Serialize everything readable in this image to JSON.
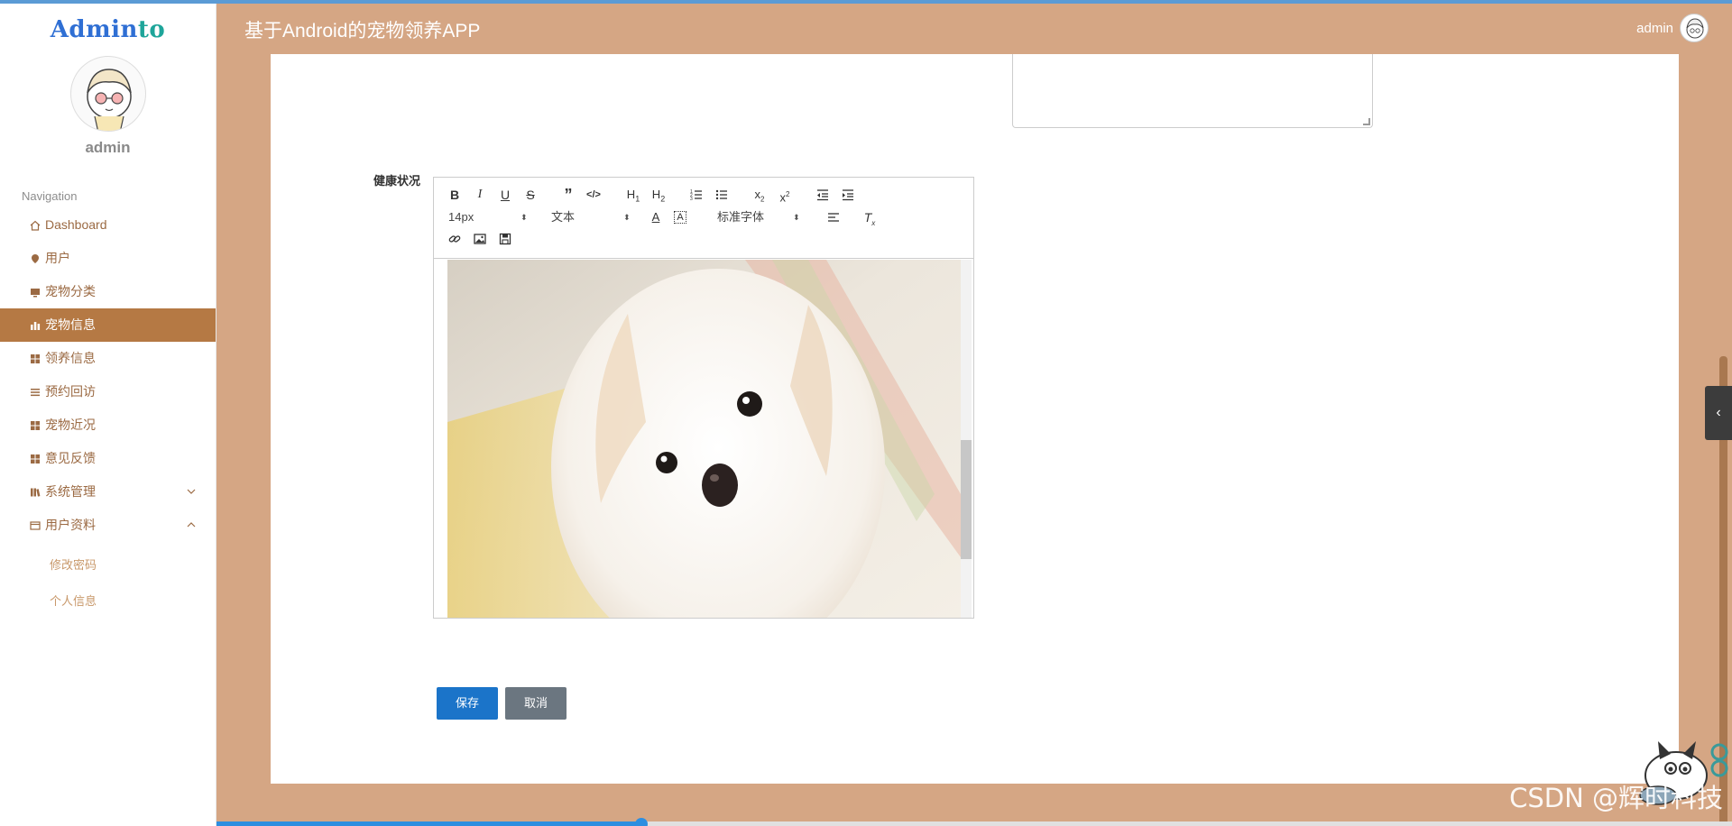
{
  "app": {
    "logo_part1": "Admin",
    "logo_part2": "to",
    "title": "基于Android的宠物领养APP"
  },
  "header": {
    "username": "admin"
  },
  "sidebar": {
    "username": "admin",
    "nav_title": "Navigation",
    "items": [
      {
        "label": "Dashboard",
        "icon": "home-icon"
      },
      {
        "label": "用户",
        "icon": "pin-icon"
      },
      {
        "label": "宠物分类",
        "icon": "monitor-icon"
      },
      {
        "label": "宠物信息",
        "icon": "bar-chart-icon",
        "active": true
      },
      {
        "label": "领养信息",
        "icon": "grid-icon"
      },
      {
        "label": "预约回访",
        "icon": "list-icon"
      },
      {
        "label": "宠物近况",
        "icon": "grid-icon"
      },
      {
        "label": "意见反馈",
        "icon": "grid-icon"
      },
      {
        "label": "系统管理",
        "icon": "book-icon",
        "chevron": "chevron-down-icon"
      },
      {
        "label": "用户资料",
        "icon": "card-icon",
        "chevron": "chevron-up-icon"
      }
    ],
    "subitems": [
      {
        "label": "修改密码"
      },
      {
        "label": "个人信息"
      }
    ]
  },
  "form": {
    "health_label": "健康状况",
    "editor": {
      "font_size": "14px",
      "block_format": "文本",
      "font_family": "标准字体",
      "image_description_icon": "dog-photo"
    },
    "save_label": "保存",
    "cancel_label": "取消"
  },
  "overlay": {
    "watermark": "CSDN @辉时科技"
  },
  "colors": {
    "accent": "#d5a684",
    "active_nav": "#b57944",
    "primary_button": "#1b74c9",
    "secondary_button": "#6b7680"
  }
}
